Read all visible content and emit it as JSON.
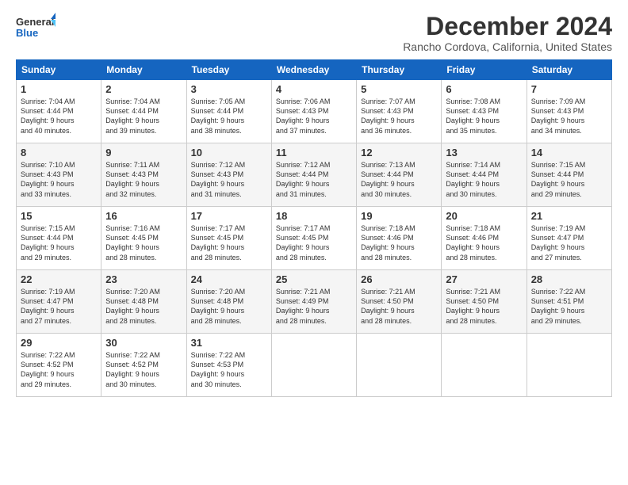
{
  "logo": {
    "line1": "General",
    "line2": "Blue"
  },
  "title": "December 2024",
  "location": "Rancho Cordova, California, United States",
  "weekdays": [
    "Sunday",
    "Monday",
    "Tuesday",
    "Wednesday",
    "Thursday",
    "Friday",
    "Saturday"
  ],
  "weeks": [
    [
      {
        "day": "1",
        "lines": [
          "Sunrise: 7:04 AM",
          "Sunset: 4:44 PM",
          "Daylight: 9 hours",
          "and 40 minutes."
        ]
      },
      {
        "day": "2",
        "lines": [
          "Sunrise: 7:04 AM",
          "Sunset: 4:44 PM",
          "Daylight: 9 hours",
          "and 39 minutes."
        ]
      },
      {
        "day": "3",
        "lines": [
          "Sunrise: 7:05 AM",
          "Sunset: 4:44 PM",
          "Daylight: 9 hours",
          "and 38 minutes."
        ]
      },
      {
        "day": "4",
        "lines": [
          "Sunrise: 7:06 AM",
          "Sunset: 4:43 PM",
          "Daylight: 9 hours",
          "and 37 minutes."
        ]
      },
      {
        "day": "5",
        "lines": [
          "Sunrise: 7:07 AM",
          "Sunset: 4:43 PM",
          "Daylight: 9 hours",
          "and 36 minutes."
        ]
      },
      {
        "day": "6",
        "lines": [
          "Sunrise: 7:08 AM",
          "Sunset: 4:43 PM",
          "Daylight: 9 hours",
          "and 35 minutes."
        ]
      },
      {
        "day": "7",
        "lines": [
          "Sunrise: 7:09 AM",
          "Sunset: 4:43 PM",
          "Daylight: 9 hours",
          "and 34 minutes."
        ]
      }
    ],
    [
      {
        "day": "8",
        "lines": [
          "Sunrise: 7:10 AM",
          "Sunset: 4:43 PM",
          "Daylight: 9 hours",
          "and 33 minutes."
        ]
      },
      {
        "day": "9",
        "lines": [
          "Sunrise: 7:11 AM",
          "Sunset: 4:43 PM",
          "Daylight: 9 hours",
          "and 32 minutes."
        ]
      },
      {
        "day": "10",
        "lines": [
          "Sunrise: 7:12 AM",
          "Sunset: 4:43 PM",
          "Daylight: 9 hours",
          "and 31 minutes."
        ]
      },
      {
        "day": "11",
        "lines": [
          "Sunrise: 7:12 AM",
          "Sunset: 4:44 PM",
          "Daylight: 9 hours",
          "and 31 minutes."
        ]
      },
      {
        "day": "12",
        "lines": [
          "Sunrise: 7:13 AM",
          "Sunset: 4:44 PM",
          "Daylight: 9 hours",
          "and 30 minutes."
        ]
      },
      {
        "day": "13",
        "lines": [
          "Sunrise: 7:14 AM",
          "Sunset: 4:44 PM",
          "Daylight: 9 hours",
          "and 30 minutes."
        ]
      },
      {
        "day": "14",
        "lines": [
          "Sunrise: 7:15 AM",
          "Sunset: 4:44 PM",
          "Daylight: 9 hours",
          "and 29 minutes."
        ]
      }
    ],
    [
      {
        "day": "15",
        "lines": [
          "Sunrise: 7:15 AM",
          "Sunset: 4:44 PM",
          "Daylight: 9 hours",
          "and 29 minutes."
        ]
      },
      {
        "day": "16",
        "lines": [
          "Sunrise: 7:16 AM",
          "Sunset: 4:45 PM",
          "Daylight: 9 hours",
          "and 28 minutes."
        ]
      },
      {
        "day": "17",
        "lines": [
          "Sunrise: 7:17 AM",
          "Sunset: 4:45 PM",
          "Daylight: 9 hours",
          "and 28 minutes."
        ]
      },
      {
        "day": "18",
        "lines": [
          "Sunrise: 7:17 AM",
          "Sunset: 4:45 PM",
          "Daylight: 9 hours",
          "and 28 minutes."
        ]
      },
      {
        "day": "19",
        "lines": [
          "Sunrise: 7:18 AM",
          "Sunset: 4:46 PM",
          "Daylight: 9 hours",
          "and 28 minutes."
        ]
      },
      {
        "day": "20",
        "lines": [
          "Sunrise: 7:18 AM",
          "Sunset: 4:46 PM",
          "Daylight: 9 hours",
          "and 28 minutes."
        ]
      },
      {
        "day": "21",
        "lines": [
          "Sunrise: 7:19 AM",
          "Sunset: 4:47 PM",
          "Daylight: 9 hours",
          "and 27 minutes."
        ]
      }
    ],
    [
      {
        "day": "22",
        "lines": [
          "Sunrise: 7:19 AM",
          "Sunset: 4:47 PM",
          "Daylight: 9 hours",
          "and 27 minutes."
        ]
      },
      {
        "day": "23",
        "lines": [
          "Sunrise: 7:20 AM",
          "Sunset: 4:48 PM",
          "Daylight: 9 hours",
          "and 28 minutes."
        ]
      },
      {
        "day": "24",
        "lines": [
          "Sunrise: 7:20 AM",
          "Sunset: 4:48 PM",
          "Daylight: 9 hours",
          "and 28 minutes."
        ]
      },
      {
        "day": "25",
        "lines": [
          "Sunrise: 7:21 AM",
          "Sunset: 4:49 PM",
          "Daylight: 9 hours",
          "and 28 minutes."
        ]
      },
      {
        "day": "26",
        "lines": [
          "Sunrise: 7:21 AM",
          "Sunset: 4:50 PM",
          "Daylight: 9 hours",
          "and 28 minutes."
        ]
      },
      {
        "day": "27",
        "lines": [
          "Sunrise: 7:21 AM",
          "Sunset: 4:50 PM",
          "Daylight: 9 hours",
          "and 28 minutes."
        ]
      },
      {
        "day": "28",
        "lines": [
          "Sunrise: 7:22 AM",
          "Sunset: 4:51 PM",
          "Daylight: 9 hours",
          "and 29 minutes."
        ]
      }
    ],
    [
      {
        "day": "29",
        "lines": [
          "Sunrise: 7:22 AM",
          "Sunset: 4:52 PM",
          "Daylight: 9 hours",
          "and 29 minutes."
        ]
      },
      {
        "day": "30",
        "lines": [
          "Sunrise: 7:22 AM",
          "Sunset: 4:52 PM",
          "Daylight: 9 hours",
          "and 30 minutes."
        ]
      },
      {
        "day": "31",
        "lines": [
          "Sunrise: 7:22 AM",
          "Sunset: 4:53 PM",
          "Daylight: 9 hours",
          "and 30 minutes."
        ]
      },
      null,
      null,
      null,
      null
    ]
  ]
}
